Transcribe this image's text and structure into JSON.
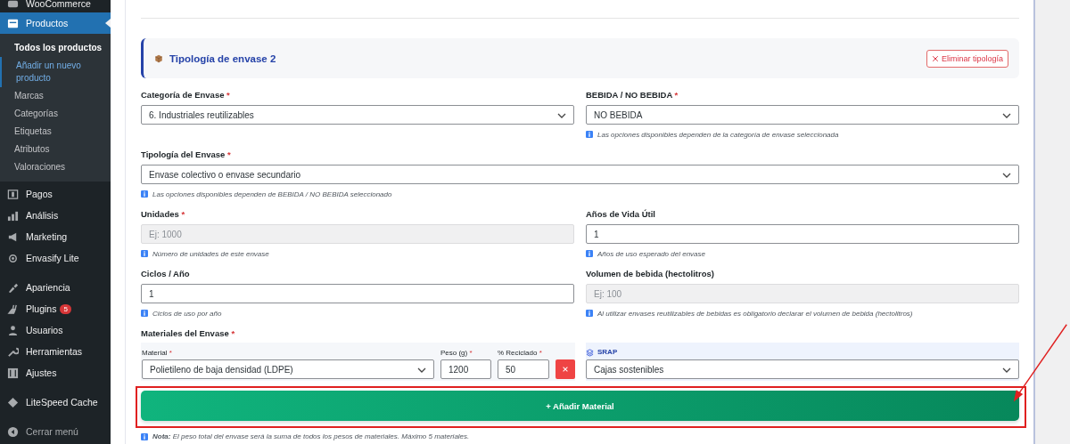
{
  "sidebar": {
    "groups": [
      [
        {
          "label": "WooCommerce",
          "selected": false
        },
        {
          "label": "Productos",
          "selected": true,
          "children": [
            {
              "label": "Todos los productos",
              "selected": true,
              "focused": false
            },
            {
              "label": "Añadir un nuevo producto",
              "selected": false,
              "focused": true
            },
            {
              "label": "Marcas",
              "selected": false,
              "focused": false
            },
            {
              "label": "Categorías",
              "selected": false,
              "focused": false
            },
            {
              "label": "Etiquetas",
              "selected": false,
              "focused": false
            },
            {
              "label": "Atributos",
              "selected": false,
              "focused": false
            },
            {
              "label": "Valoraciones",
              "selected": false,
              "focused": false
            }
          ]
        },
        {
          "label": "Pagos",
          "selected": false
        },
        {
          "label": "Análisis",
          "selected": false
        },
        {
          "label": "Marketing",
          "selected": false
        },
        {
          "label": "Envasify Lite",
          "selected": false
        }
      ],
      [
        {
          "label": "Apariencia",
          "selected": false
        },
        {
          "label": "Plugins",
          "selected": false,
          "badge": "5"
        },
        {
          "label": "Usuarios",
          "selected": false
        },
        {
          "label": "Herramientas",
          "selected": false
        },
        {
          "label": "Ajustes",
          "selected": false
        }
      ],
      [
        {
          "label": "LiteSpeed Cache",
          "selected": false
        }
      ]
    ],
    "collapse": "Cerrar menú"
  },
  "section": {
    "title": "Tipología de envase 2",
    "remove_button": "Eliminar tipología"
  },
  "fields": [
    {
      "label": "Categoría de Envase",
      "marker": "*",
      "kind": "select",
      "value": "6. Industriales reutilizables",
      "full": false,
      "disabled": false
    },
    {
      "label": "BEBIDA / NO BEBIDA",
      "marker": "*",
      "kind": "select",
      "value": "NO BEBIDA",
      "full": false,
      "disabled": false,
      "hint": "Las opciones disponibles dependen de la categoría de envase seleccionada"
    },
    {
      "label": "Tipología del Envase",
      "marker": "*",
      "kind": "select",
      "value": "Envase colectivo o envase secundario",
      "full": true,
      "disabled": false,
      "hint": "Las opciones disponibles dependen de BEBIDA / NO BEBIDA seleccionado"
    },
    {
      "label": "Unidades",
      "marker": "*",
      "kind": "input",
      "placeholder": "Ej: 1000",
      "full": false,
      "disabled": true,
      "hint": "Número de unidades de este envase"
    },
    {
      "label": "Años de Vida Útil",
      "kind": "input",
      "value": "1",
      "full": false,
      "disabled": false,
      "hint": "Años de uso esperado del envase"
    },
    {
      "label": "Ciclos / Año",
      "kind": "input",
      "value": "1",
      "full": false,
      "disabled": false,
      "hint": "Ciclos de uso por año"
    },
    {
      "label": "Volumen de bebida (hectolitros)",
      "kind": "input",
      "placeholder": "Ej: 100",
      "full": false,
      "disabled": true,
      "hint": "Al utilizar envases reutilizables de bebidas es obligatorio declarar el volumen de bebida (hectolitros)"
    }
  ],
  "materials": {
    "label": "Materiales del Envase",
    "marker": "*",
    "rows": [
      {
        "material": {
          "label": "Material",
          "marker": "*",
          "value": "Polietileno de baja densidad (LDPE)"
        },
        "weight": {
          "label": "Peso (g)",
          "marker": "*",
          "value": "1200"
        },
        "recycled": {
          "label": "% Reciclado",
          "marker": "*",
          "value": "50"
        },
        "srap": {
          "label": "SRAP",
          "value": "Cajas sostenibles"
        }
      }
    ],
    "add_button": "+ Añadir Material",
    "note": "**Nota:** El peso total del envase será la suma de todos los pesos de materiales. Máximo 5 materiales."
  }
}
